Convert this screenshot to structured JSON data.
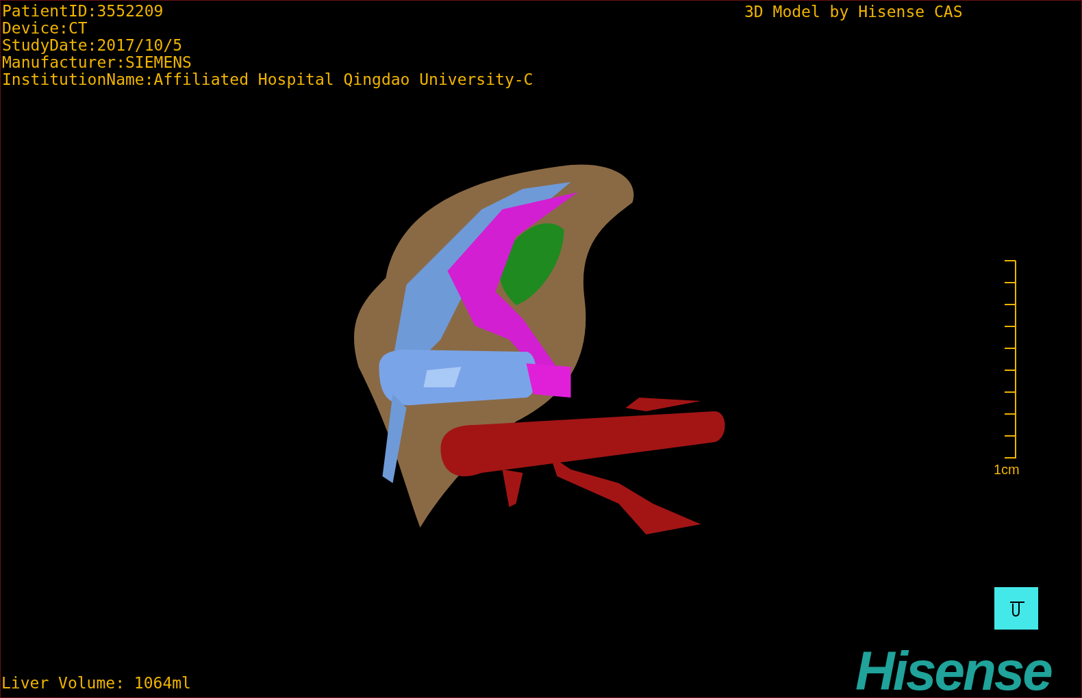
{
  "info_lines": [
    "PatientID:3552209",
    "Device:CT",
    "StudyDate:2017/10/5",
    "Manufacturer:SIEMENS",
    "InstitutionName:Affiliated Hospital Qingdao University-C"
  ],
  "title": "3D Model by Hisense CAS",
  "scale": {
    "label": "1cm"
  },
  "volume": "Liver Volume: 1064ml",
  "logo": "Hisense"
}
